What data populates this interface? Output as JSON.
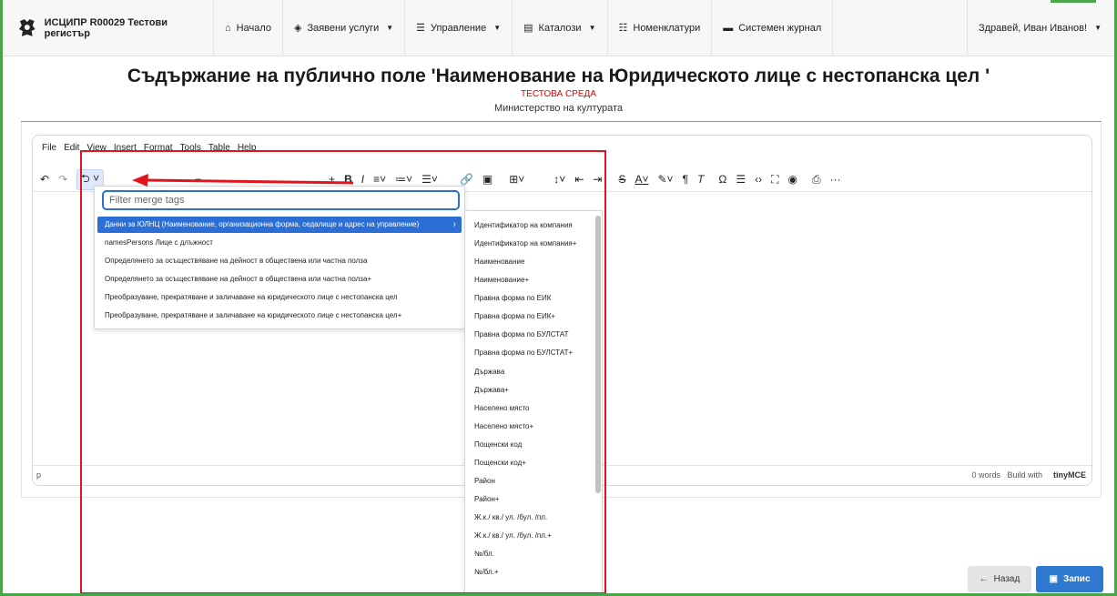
{
  "navbar": {
    "brand": "ИСЦИПР R00029 Тестови регистър",
    "items": [
      {
        "icon": "home-icon",
        "glyph": "⌂",
        "label": "Начало",
        "caret": false
      },
      {
        "icon": "stack-icon",
        "glyph": "◈",
        "label": "Заявени услуги",
        "caret": true
      },
      {
        "icon": "sliders-icon",
        "glyph": "☰",
        "label": "Управление",
        "caret": true
      },
      {
        "icon": "catalog-icon",
        "glyph": "▤",
        "label": "Каталози",
        "caret": true
      },
      {
        "icon": "list-icon",
        "glyph": "☷",
        "label": "Номенклатури",
        "caret": false
      },
      {
        "icon": "journal-icon",
        "glyph": "▬",
        "label": "Системен журнал",
        "caret": false
      }
    ],
    "user": "Здравей, Иван Иванов!"
  },
  "page": {
    "title": "Съдържание на публично поле 'Наименование на Юридическото лице с нестопанска цел '",
    "environment": "ТЕСТОВА СРЕДА",
    "ministry": "Министерство на културата"
  },
  "editor": {
    "menu": [
      "File",
      "Edit",
      "View",
      "Insert",
      "Format",
      "Tools",
      "Table",
      "Help"
    ],
    "status_path": "p",
    "word_count": "0 words",
    "build_with": "Build with",
    "tiny_brand": "tinyMCE"
  },
  "merge_tags": {
    "placeholder": "Filter merge tags",
    "items": [
      "Данни за ЮЛНЦ (Наименование, организационна форма, седалище и адрес на управление)",
      "namesPersons Лице с длъжност",
      "Определянето за осъществяване на дейност в обществена или частна полза",
      "Определянето за осъществяване на дейност в обществена или частна полза+",
      "Преобразуване, прекратяване и заличаване на юридическото лице с нестопанска цел",
      "Преобразуване, прекратяване и заличаване на юридическото лице с нестопанска цел+"
    ],
    "submenu": [
      "Идентификатор на компания",
      "Идентификатор на компания+",
      "Наименование",
      "Наименование+",
      "Правна форма по ЕИК",
      "Правна форма по ЕИК+",
      "Правна форма по БУЛСТАТ",
      "Правна форма по БУЛСТАТ+",
      "Държава",
      "Държава+",
      "Населено място",
      "Населено място+",
      "Пощенски код",
      "Пощенски код+",
      "Район",
      "Район+",
      "Ж.к./ кв./ ул. /бул. /пл.",
      "Ж.к./ кв./ ул. /бул. /пл.+",
      "№/бл.",
      "№/бл.+"
    ]
  },
  "buttons": {
    "back": "Назад",
    "save": "Запис"
  },
  "colors": {
    "primary": "#2e78cf",
    "highlight": "#e3141b",
    "env": "#e00000",
    "frame": "#4aa54a"
  }
}
